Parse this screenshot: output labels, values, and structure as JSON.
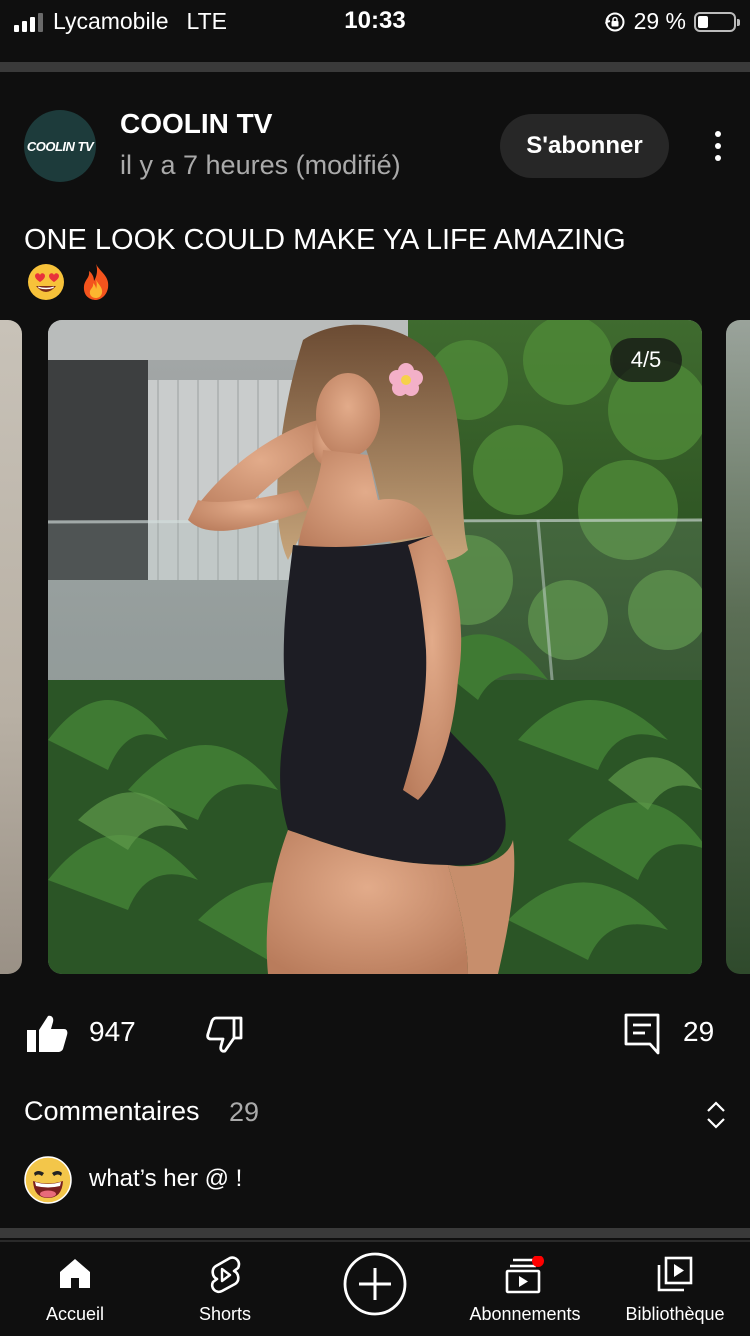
{
  "status_bar": {
    "carrier": "Lycamobile",
    "network": "LTE",
    "time": "10:33",
    "battery_text": "29 %",
    "battery_level": 0.29
  },
  "post": {
    "channel_avatar_text": "COOLIN TV",
    "channel_name": "COOLIN TV",
    "timestamp": "il y a 7 heures (modifié)",
    "subscribe_label": "S'abonner",
    "text": "ONE LOOK COULD MAKE YA LIFE AMAZING",
    "emojis": [
      "😍",
      "🔥"
    ],
    "image_counter": "4/5"
  },
  "actions": {
    "like_count": "947",
    "comment_count": "29"
  },
  "comments": {
    "title": "Commentaires",
    "count": "29",
    "top_comment": "what’s her @ !"
  },
  "nav": {
    "home": "Accueil",
    "shorts": "Shorts",
    "subscriptions": "Abonnements",
    "library": "Bibliothèque"
  },
  "colors": {
    "background": "#0f0f0f",
    "button": "#272727",
    "notification_dot": "#ff0000"
  }
}
